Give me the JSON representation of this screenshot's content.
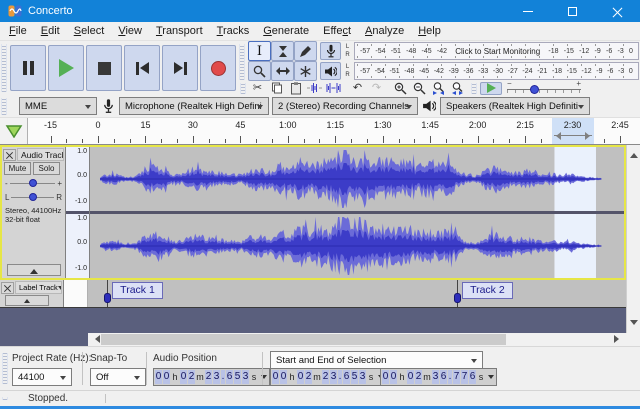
{
  "window": {
    "title": "Concerto"
  },
  "menu": {
    "items": [
      {
        "label": "File",
        "u": 0
      },
      {
        "label": "Edit",
        "u": 0
      },
      {
        "label": "Select",
        "u": 0
      },
      {
        "label": "View",
        "u": 0
      },
      {
        "label": "Transport",
        "u": 0
      },
      {
        "label": "Tracks",
        "u": 0
      },
      {
        "label": "Generate",
        "u": 0
      },
      {
        "label": "Effect",
        "u": 4
      },
      {
        "label": "Analyze",
        "u": 0
      },
      {
        "label": "Help",
        "u": 0
      }
    ]
  },
  "transport": {
    "buttons": [
      "Pause",
      "Play",
      "Stop",
      "Skip to Start",
      "Skip to End",
      "Record"
    ]
  },
  "tools": {
    "buttons": [
      "Selection Tool",
      "Envelope Tool",
      "Draw Tool",
      "Zoom Tool",
      "Time Shift Tool",
      "Multi-Tool"
    ],
    "selected": "Selection Tool"
  },
  "meters": {
    "channel_labels": [
      "L",
      "R"
    ],
    "recording": {
      "left_numbers": [
        "-57",
        "-54",
        "-51",
        "-48",
        "-45",
        "-42"
      ],
      "monitor_text": "Click to Start Monitoring",
      "right_numbers": [
        "-18",
        "-15",
        "-12",
        "-9",
        "-6",
        "-3",
        "0"
      ]
    },
    "playback": {
      "numbers": [
        "-57",
        "-54",
        "-51",
        "-48",
        "-45",
        "-42",
        "-39",
        "-36",
        "-33",
        "-30",
        "-27",
        "-24",
        "-21",
        "-18",
        "-15",
        "-12",
        "-9",
        "-6",
        "-3",
        "0"
      ]
    }
  },
  "edit_toolbar": {
    "buttons": [
      "Cut",
      "Copy",
      "Paste",
      "Trim audio outside selection",
      "Silence audio selection",
      "Undo",
      "Redo",
      "Zoom In",
      "Zoom Out",
      "Fit selection to width",
      "Fit project to width"
    ],
    "disabled": [
      "Redo"
    ]
  },
  "play_at_speed": {
    "name": "Play-at-Speed",
    "speed_position": 0.33
  },
  "device": {
    "host": "MME",
    "input": "Microphone (Realtek High Defini",
    "channels": "2 (Stereo) Recording Channels",
    "output": "Speakers (Realtek High Definiti"
  },
  "ruler": {
    "major_labels": [
      "-15",
      "0",
      "15",
      "30",
      "45",
      "1:00",
      "1:15",
      "1:30",
      "1:45",
      "2:00",
      "2:15",
      "2:30",
      "2:45"
    ],
    "major_start_s": -15,
    "major_step_s": 15,
    "selection": {
      "start_s": 143.653,
      "end_s": 156.776
    }
  },
  "audio_track": {
    "name": "Audio Track",
    "mute": "Mute",
    "solo": "Solo",
    "gain_min": "-",
    "gain_max": "+",
    "pan_left": "L",
    "pan_right": "R",
    "info1": "Stereo, 44100Hz",
    "info2": "32-bit float",
    "scale": [
      "1.0",
      "0.0",
      "-1.0"
    ],
    "end_s": 158.5,
    "envelope": [
      [
        0,
        0.03
      ],
      [
        0.01,
        0.1
      ],
      [
        0.03,
        0.12
      ],
      [
        0.05,
        0.05
      ],
      [
        0.07,
        0.06
      ],
      [
        0.09,
        0.26
      ],
      [
        0.11,
        0.33
      ],
      [
        0.13,
        0.28
      ],
      [
        0.145,
        0.12
      ],
      [
        0.16,
        0.1
      ],
      [
        0.18,
        0.24
      ],
      [
        0.2,
        0.27
      ],
      [
        0.22,
        0.2
      ],
      [
        0.24,
        0.16
      ],
      [
        0.26,
        0.13
      ],
      [
        0.28,
        0.1
      ],
      [
        0.3,
        0.22
      ],
      [
        0.32,
        0.26
      ],
      [
        0.34,
        0.18
      ],
      [
        0.36,
        0.36
      ],
      [
        0.38,
        0.28
      ],
      [
        0.4,
        0.43
      ],
      [
        0.42,
        0.35
      ],
      [
        0.44,
        0.5
      ],
      [
        0.455,
        0.4
      ],
      [
        0.47,
        0.58
      ],
      [
        0.485,
        0.75
      ],
      [
        0.5,
        0.62
      ],
      [
        0.515,
        0.48
      ],
      [
        0.53,
        0.56
      ],
      [
        0.55,
        0.4
      ],
      [
        0.57,
        0.5
      ],
      [
        0.59,
        0.36
      ],
      [
        0.61,
        0.44
      ],
      [
        0.63,
        0.32
      ],
      [
        0.65,
        0.42
      ],
      [
        0.67,
        0.3
      ],
      [
        0.69,
        0.38
      ],
      [
        0.71,
        0.26
      ],
      [
        0.73,
        0.1
      ],
      [
        0.75,
        0.07
      ],
      [
        0.77,
        0.22
      ],
      [
        0.79,
        0.3
      ],
      [
        0.81,
        0.23
      ],
      [
        0.83,
        0.16
      ],
      [
        0.85,
        0.21
      ],
      [
        0.87,
        0.15
      ],
      [
        0.89,
        0.1
      ],
      [
        0.905,
        0.13
      ],
      [
        0.92,
        0.08
      ],
      [
        0.94,
        0.11
      ],
      [
        0.96,
        0.06
      ],
      [
        0.98,
        0.04
      ],
      [
        1,
        0.02
      ]
    ]
  },
  "label_track": {
    "name": "Label Track",
    "labels": [
      {
        "text": "Track 1",
        "time_s": 2.9
      },
      {
        "text": "Track 2",
        "time_s": 113.5
      }
    ]
  },
  "selection_toolbar": {
    "project_rate_label": "Project Rate (Hz):",
    "project_rate": "44100",
    "snap_label": "Snap-To",
    "snap": "Off",
    "audio_position_label": "Audio Position",
    "audio_position": {
      "h": "00",
      "m": "02",
      "s": "23.653"
    },
    "range_mode": "Start and End of Selection",
    "sel_start": {
      "h": "00",
      "m": "02",
      "s": "23.653"
    },
    "sel_end": {
      "h": "00",
      "m": "02",
      "s": "36.776"
    }
  },
  "status": {
    "text": "Stopped."
  },
  "colors": {
    "titlebar": "#1282d8",
    "accent_border": "#2e8ae0",
    "button_face": "#ced8ee",
    "wave": "#3c3cc8",
    "wave_peak": "#6b6bd8",
    "track_bg": "#c0c0c0",
    "focus_border": "#e6e646",
    "selection_bg": "#eaf1fc",
    "dark_bg": "#5a5f7d"
  }
}
